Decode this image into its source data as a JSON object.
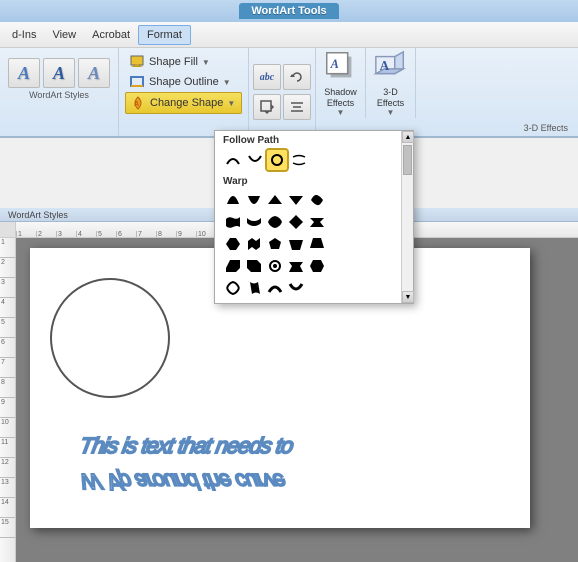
{
  "titleBar": {
    "label": "WordArt Tools"
  },
  "menuBar": {
    "items": [
      {
        "id": "add-ins",
        "label": "d-Ins"
      },
      {
        "id": "view",
        "label": "View"
      },
      {
        "id": "acrobat",
        "label": "Acrobat"
      },
      {
        "id": "format",
        "label": "Format",
        "active": true
      }
    ]
  },
  "ribbon": {
    "groups": [
      {
        "id": "wordart-styles",
        "label": "WordArt Styles",
        "buttons": [
          {
            "id": "style1",
            "text": "A"
          },
          {
            "id": "style2",
            "text": "A"
          },
          {
            "id": "style3",
            "text": "A"
          }
        ]
      },
      {
        "id": "text-options",
        "items": [
          {
            "id": "shape-fill",
            "label": "Shape Fill",
            "icon": "fill-icon"
          },
          {
            "id": "shape-outline",
            "label": "Shape Outline",
            "icon": "outline-icon"
          },
          {
            "id": "change-shape",
            "label": "Change Shape",
            "icon": "shape-icon",
            "active": true
          }
        ]
      },
      {
        "id": "shadow-effects",
        "label": "Shadow Effects",
        "icon": "shadow-icon"
      },
      {
        "id": "3d-effects",
        "label": "3-D Effects",
        "icon": "3d-icon"
      }
    ],
    "extraButtons": [
      {
        "id": "rotate-btn",
        "icon": "rotate-icon"
      },
      {
        "id": "position-btn",
        "icon": "position-icon"
      }
    ]
  },
  "dropdown": {
    "title": "Change Shape",
    "sections": [
      {
        "id": "follow-path",
        "label": "Follow Path",
        "shapes": [
          {
            "id": "arch-up",
            "selected": false
          },
          {
            "id": "arch-down",
            "selected": false
          },
          {
            "id": "circle",
            "selected": true
          },
          {
            "id": "button",
            "selected": false
          }
        ]
      },
      {
        "id": "warp",
        "label": "Warp",
        "shapes": [
          {
            "id": "warp1"
          },
          {
            "id": "warp2"
          },
          {
            "id": "warp3"
          },
          {
            "id": "warp4"
          },
          {
            "id": "warp5"
          },
          {
            "id": "warp6"
          },
          {
            "id": "warp7"
          },
          {
            "id": "warp8"
          },
          {
            "id": "warp9"
          },
          {
            "id": "warp10"
          },
          {
            "id": "warp11"
          },
          {
            "id": "warp12"
          },
          {
            "id": "warp13"
          },
          {
            "id": "warp14"
          },
          {
            "id": "warp15"
          },
          {
            "id": "warp16"
          },
          {
            "id": "warp17"
          },
          {
            "id": "warp18"
          },
          {
            "id": "warp19"
          },
          {
            "id": "warp20"
          },
          {
            "id": "warp21"
          },
          {
            "id": "warp22"
          },
          {
            "id": "warp23"
          },
          {
            "id": "warp24"
          },
          {
            "id": "warp25"
          },
          {
            "id": "warp26"
          },
          {
            "id": "warp27"
          },
          {
            "id": "warp28"
          },
          {
            "id": "warp29"
          },
          {
            "id": "warp30"
          },
          {
            "id": "warp31"
          },
          {
            "id": "warp32"
          },
          {
            "id": "warp33"
          },
          {
            "id": "warp34"
          },
          {
            "id": "warp35"
          },
          {
            "id": "warp36"
          },
          {
            "id": "warp37"
          },
          {
            "id": "warp38"
          },
          {
            "id": "warp39"
          },
          {
            "id": "warp40"
          },
          {
            "id": "warp41"
          },
          {
            "id": "warp42"
          },
          {
            "id": "warp43"
          },
          {
            "id": "warp44"
          },
          {
            "id": "warp45"
          }
        ]
      }
    ]
  },
  "canvas": {
    "wordartText1": "This is text that needs to",
    "wordartText2": "W ∀ p around the curve"
  },
  "sectionLabels": {
    "followPath": "Follow Path",
    "warp": "Warp"
  }
}
